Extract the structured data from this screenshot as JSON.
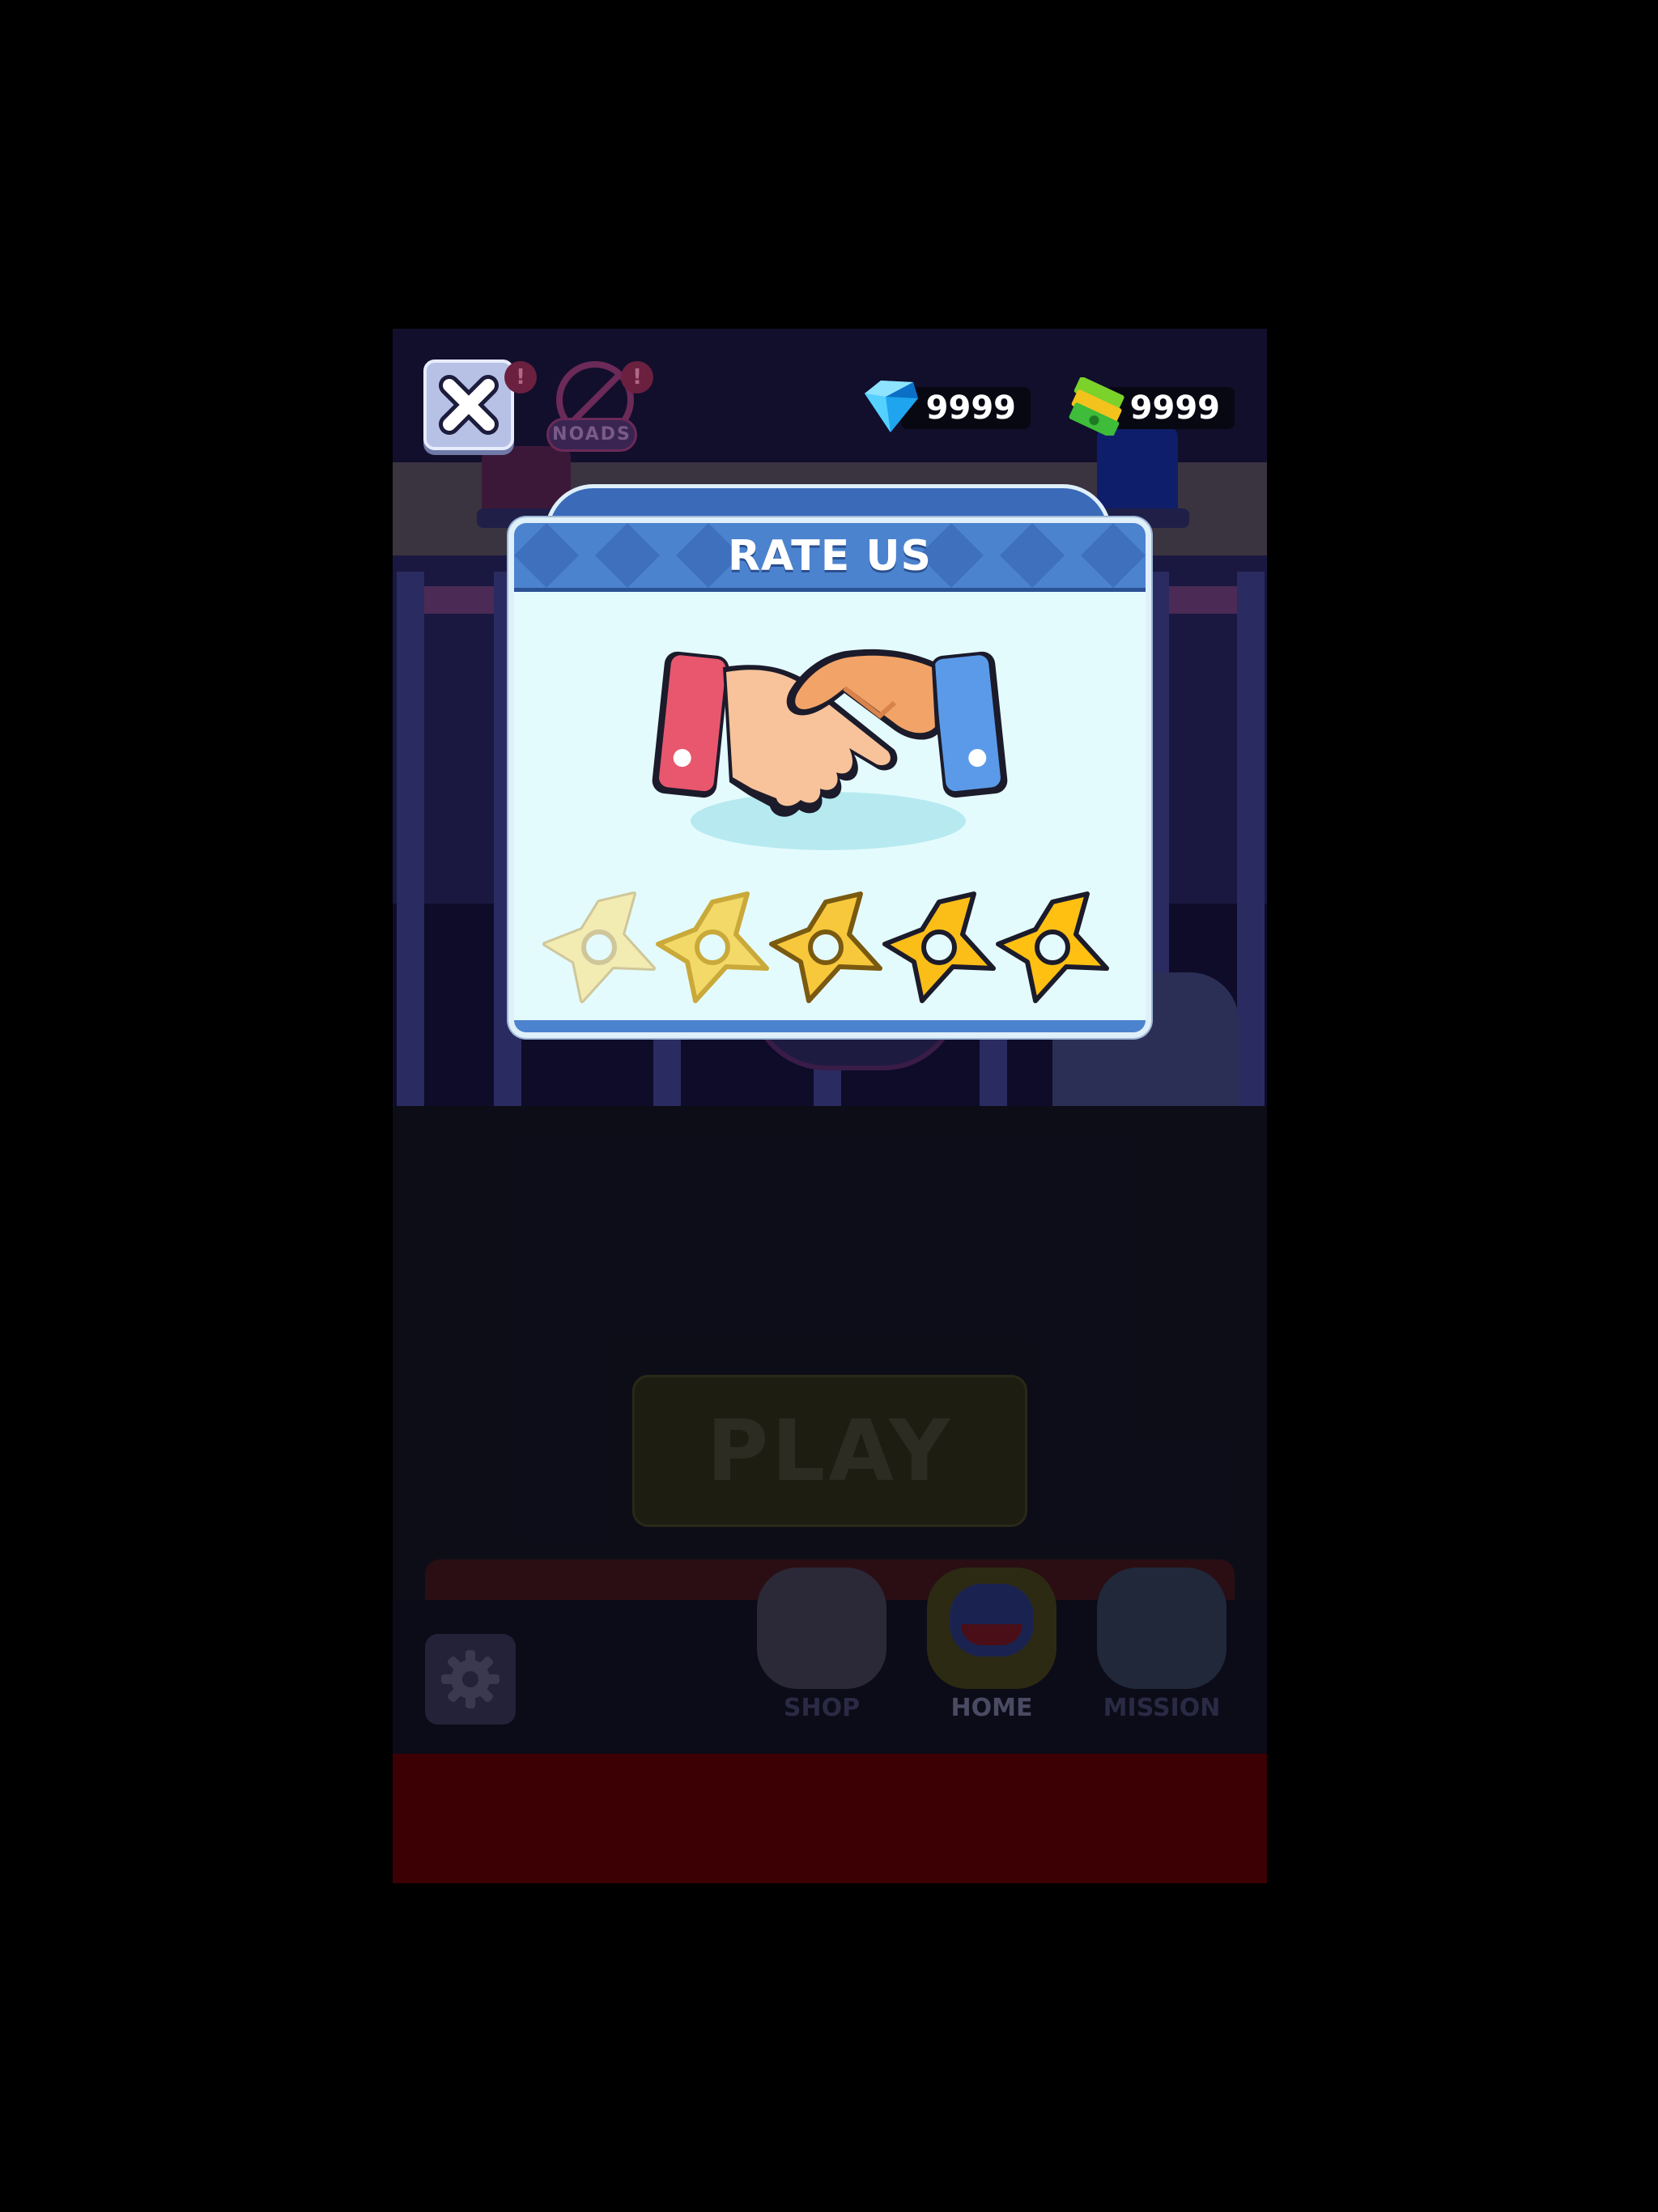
{
  "hud": {
    "close_icon": "close-x-icon",
    "noads_label": "NOADS",
    "alert_mark": "!",
    "gems": {
      "icon": "diamond-icon",
      "value": "9999"
    },
    "cash": {
      "icon": "cash-stack-icon",
      "value": "9999"
    }
  },
  "background": {
    "play_label": "PLAY",
    "nav": [
      {
        "label": "SHOP",
        "icon": "shop-icon"
      },
      {
        "label": "HOME",
        "icon": "huggy-face-icon"
      },
      {
        "label": "MISSION",
        "icon": "mission-icon"
      }
    ],
    "settings_icon": "gear-icon"
  },
  "dialog": {
    "title": "RATE US",
    "illustration": "handshake-icon",
    "stars_total": 5,
    "star_colors": [
      "#f2ebb2",
      "#f3d968",
      "#f8c83c",
      "#fbbd17",
      "#ffc012"
    ]
  },
  "colors": {
    "dialog_header": "#4c83cf",
    "dialog_body": "#e4fbfd",
    "ad_bar": "#3c0004"
  }
}
